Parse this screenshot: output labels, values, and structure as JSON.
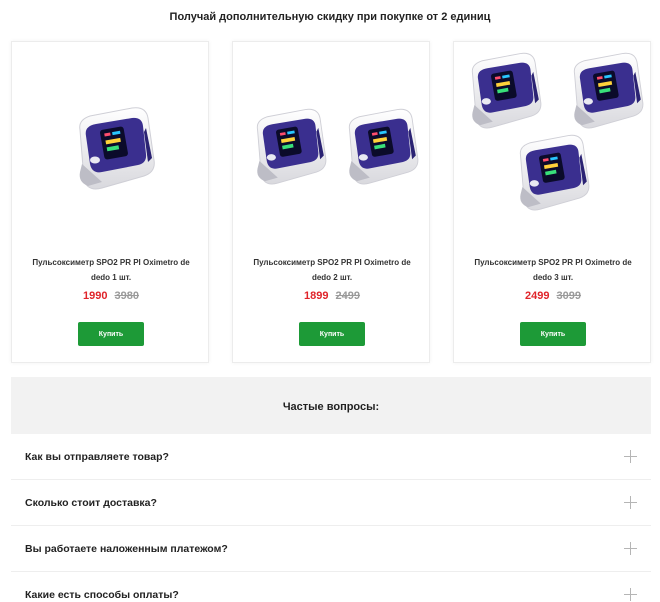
{
  "promo": {
    "title": "Получай дополнительную скидку при покупке от 2 единиц"
  },
  "colors": {
    "accent_green": "#1d9a37",
    "price_red": "#e0242a",
    "device_blue": "#3a2f8f"
  },
  "products": [
    {
      "name": "Пульсоксиметр SPO2 PR PI Oximetro de dedo 1 шт.",
      "price_new": "1990",
      "price_old": "3980",
      "button": "Купить",
      "image": "pulse-oximeter-x1"
    },
    {
      "name": "Пульсоксиметр SPO2 PR PI Oximetro de dedo 2 шт.",
      "price_new": "1899",
      "price_old": "2499",
      "button": "Купить",
      "image": "pulse-oximeter-x2"
    },
    {
      "name": "Пульсоксиметр SPO2 PR PI Oximetro de dedo 3 шт.",
      "price_new": "2499",
      "price_old": "3099",
      "button": "Купить",
      "image": "pulse-oximeter-x3"
    }
  ],
  "faq": {
    "title": "Частые вопросы:",
    "items": [
      {
        "question": "Как вы отправляете товар?",
        "icon": "plus-icon"
      },
      {
        "question": "Сколько стоит доставка?",
        "icon": "plus-icon"
      },
      {
        "question": "Вы работаете наложенным платежом?",
        "icon": "plus-icon"
      },
      {
        "question": "Какие есть способы оплаты?",
        "icon": "plus-icon"
      }
    ]
  }
}
